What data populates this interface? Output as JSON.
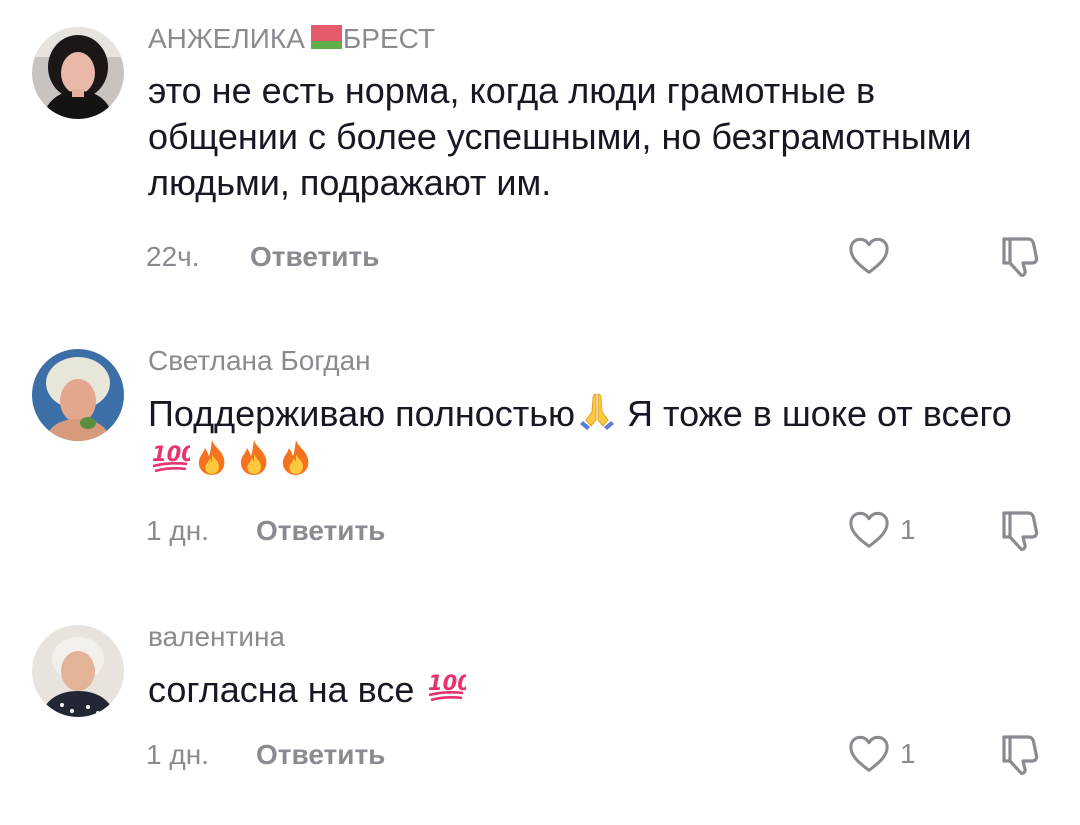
{
  "colors": {
    "text": "#161823",
    "muted": "#8a8b91",
    "flag_red": "#e35b6c",
    "flag_green": "#5fae4a",
    "emoji_100": "#e8336d",
    "emoji_fire": "#f5731f"
  },
  "comments": [
    {
      "author_part1": "АНЖЕЛИКА",
      "author_flag": "belarus-flag-emoji",
      "author_part2": "БРЕСТ",
      "text": "это не есть норма, когда люди грамотные в общении с более успешными, но безграмотными людьми, подражают им.",
      "time": "22ч.",
      "reply_label": "Ответить",
      "like_count": "",
      "like_icon": "heart-icon",
      "dislike_icon": "thumbs-down-icon"
    },
    {
      "author": "Светлана Богдан",
      "text_part1": "Поддерживаю полностью",
      "text_emoji1": "folded-hands-emoji",
      "text_part2": " Я тоже в шоке от всего",
      "text_emojis": [
        "hundred-points-emoji",
        "fire-emoji",
        "fire-emoji",
        "fire-emoji"
      ],
      "time": "1 дн.",
      "reply_label": "Ответить",
      "like_count": "1",
      "like_icon": "heart-icon",
      "dislike_icon": "thumbs-down-icon"
    },
    {
      "author": "валентина",
      "text": "согласна на все ",
      "text_emoji": "hundred-points-emoji",
      "time": "1 дн.",
      "reply_label": "Ответить",
      "like_count": "1",
      "like_icon": "heart-icon",
      "dislike_icon": "thumbs-down-icon"
    }
  ]
}
